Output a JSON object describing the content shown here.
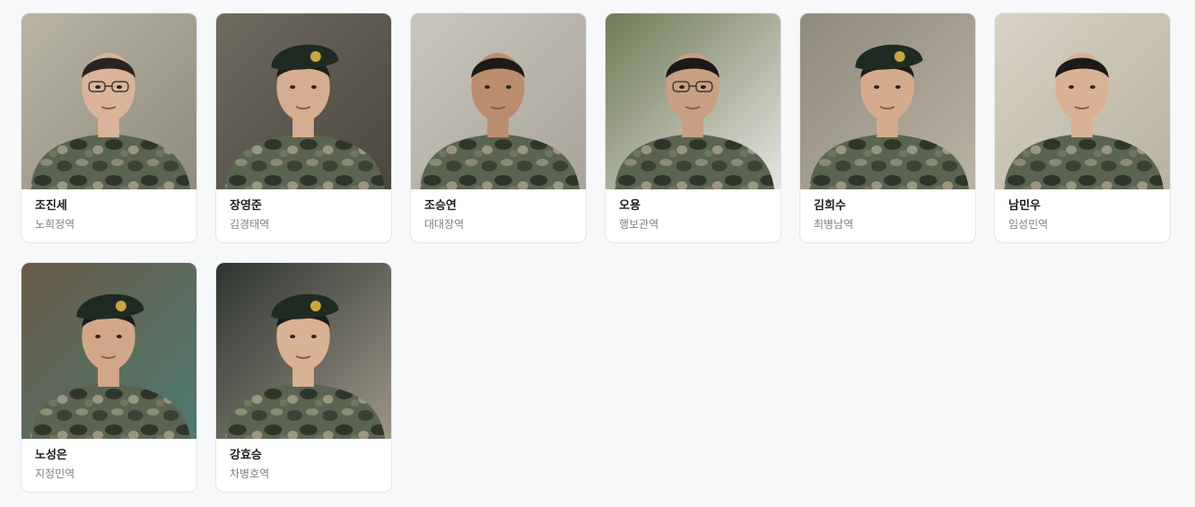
{
  "cast": [
    {
      "name": "조진세",
      "role": "노희정역",
      "photo": {
        "bg": "#b9b4a4",
        "bg2": "#8f8b7d",
        "skin": "#d9b49a",
        "hair": "#2a2420",
        "hat": null,
        "glasses": true
      }
    },
    {
      "name": "장영준",
      "role": "김경태역",
      "photo": {
        "bg": "#6e6a5e",
        "bg2": "#4a4740",
        "skin": "#d6ad90",
        "hair": "#1e1c1a",
        "hat": "#1f2a22",
        "glasses": false
      }
    },
    {
      "name": "조승연",
      "role": "대대장역",
      "photo": {
        "bg": "#c9c6bd",
        "bg2": "#a8a499",
        "skin": "#bb8d6e",
        "hair": "#1c1a18",
        "hat": null,
        "glasses": false
      }
    },
    {
      "name": "오용",
      "role": "행보관역",
      "photo": {
        "bg": "#6f7a55",
        "bg2": "#e6e4e0",
        "skin": "#c99f83",
        "hair": "#1b1918",
        "hat": null,
        "glasses": true
      }
    },
    {
      "name": "김희수",
      "role": "최병남역",
      "photo": {
        "bg": "#8f8a7c",
        "bg2": "#b9b3a4",
        "skin": "#d5ab8e",
        "hair": "#1e1c1a",
        "hat": "#1f2a22",
        "glasses": false
      }
    },
    {
      "name": "남민우",
      "role": "임성민역",
      "photo": {
        "bg": "#d8d3c4",
        "bg2": "#b8b2a1",
        "skin": "#d9b295",
        "hair": "#1d1b19",
        "hat": null,
        "glasses": false
      }
    },
    {
      "name": "노성은",
      "role": "지정민역",
      "photo": {
        "bg": "#6a5a47",
        "bg2": "#4d7a72",
        "skin": "#d2a789",
        "hair": "#1e1c1a",
        "hat": "#1f2a22",
        "glasses": false
      }
    },
    {
      "name": "강효승",
      "role": "차병호역",
      "photo": {
        "bg": "#2e3430",
        "bg2": "#9c9587",
        "skin": "#d9b193",
        "hair": "#1e1c1a",
        "hat": "#1f2a22",
        "glasses": false
      }
    }
  ],
  "colors": {
    "page_bg": "#f7f8fa",
    "card_border": "#e3e5e8",
    "name_text": "#1c1d20",
    "role_text": "#7c7f86",
    "uniform_base": "#4f5a45"
  }
}
